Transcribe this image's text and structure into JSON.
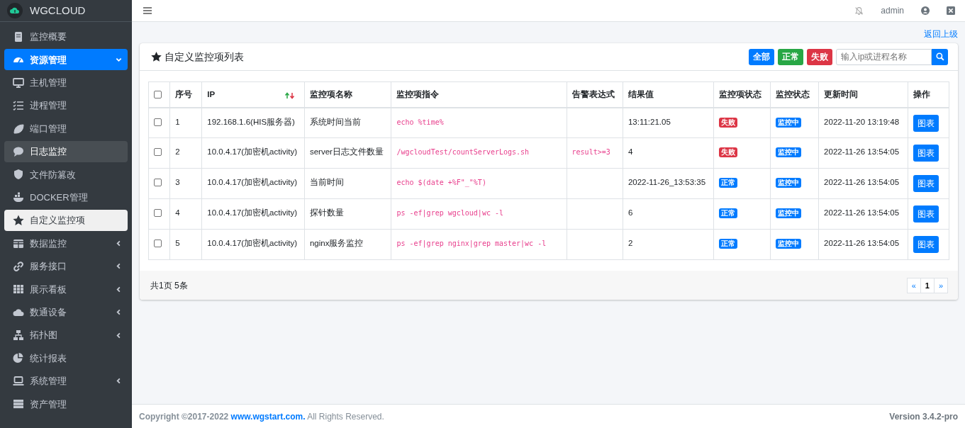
{
  "brand": {
    "name": "WGCLOUD"
  },
  "sidebar": {
    "items": [
      {
        "label": "监控概要",
        "has_submenu": false,
        "expanded": false,
        "selected": false,
        "hovered": false
      },
      {
        "label": "资源管理",
        "has_submenu": true,
        "expanded": true,
        "selected": false,
        "hovered": false
      },
      {
        "label": "主机管理",
        "has_submenu": false,
        "expanded": false,
        "selected": false,
        "hovered": false
      },
      {
        "label": "进程管理",
        "has_submenu": false,
        "expanded": false,
        "selected": false,
        "hovered": false
      },
      {
        "label": "端口管理",
        "has_submenu": false,
        "expanded": false,
        "selected": false,
        "hovered": false
      },
      {
        "label": "日志监控",
        "has_submenu": false,
        "expanded": false,
        "selected": false,
        "hovered": true
      },
      {
        "label": "文件防篡改",
        "has_submenu": false,
        "expanded": false,
        "selected": false,
        "hovered": false
      },
      {
        "label": "DOCKER管理",
        "has_submenu": false,
        "expanded": false,
        "selected": false,
        "hovered": false
      },
      {
        "label": "自定义监控项",
        "has_submenu": false,
        "expanded": false,
        "selected": true,
        "hovered": false
      },
      {
        "label": "数据监控",
        "has_submenu": true,
        "expanded": false,
        "selected": false,
        "hovered": false
      },
      {
        "label": "服务接口",
        "has_submenu": true,
        "expanded": false,
        "selected": false,
        "hovered": false
      },
      {
        "label": "展示看板",
        "has_submenu": true,
        "expanded": false,
        "selected": false,
        "hovered": false
      },
      {
        "label": "数通设备",
        "has_submenu": true,
        "expanded": false,
        "selected": false,
        "hovered": false
      },
      {
        "label": "拓扑图",
        "has_submenu": true,
        "expanded": false,
        "selected": false,
        "hovered": false
      },
      {
        "label": "统计报表",
        "has_submenu": false,
        "expanded": false,
        "selected": false,
        "hovered": false
      },
      {
        "label": "系统管理",
        "has_submenu": true,
        "expanded": false,
        "selected": false,
        "hovered": false
      },
      {
        "label": "资产管理",
        "has_submenu": false,
        "expanded": false,
        "selected": false,
        "hovered": false
      }
    ]
  },
  "topbar": {
    "user": "admin"
  },
  "back_link": "返回上级",
  "card": {
    "title": "自定义监控项列表",
    "filters": [
      {
        "label": "全部",
        "kind": "all"
      },
      {
        "label": "正常",
        "kind": "ok"
      },
      {
        "label": "失败",
        "kind": "fail"
      }
    ],
    "search": {
      "placeholder": "输入ip或进程名称"
    }
  },
  "table": {
    "select_all_checked": false,
    "columns": [
      "序号",
      "IP",
      "监控项名称",
      "监控项指令",
      "告警表达式",
      "结果值",
      "监控项状态",
      "监控状态",
      "更新时间",
      "操作"
    ],
    "rows": [
      {
        "checked": false,
        "index": "1",
        "ip": "192.168.1.6(HIS服务器)",
        "name": "系统时间当前",
        "command": "echo %time%",
        "result": "13:11:21.05",
        "item_status": {
          "label": "失败",
          "kind": "fail"
        },
        "monitor_status": "监控中",
        "updated": "2022-11-20 13:19:48",
        "action": "图表"
      },
      {
        "checked": false,
        "index": "2",
        "ip": "10.0.4.17(加密机activity)",
        "name": "server日志文件数量",
        "command": "/wgcloudTest/countServerLogs.sh",
        "expression": "result>=3",
        "result": "4",
        "item_status": {
          "label": "失败",
          "kind": "fail"
        },
        "monitor_status": "监控中",
        "updated": "2022-11-26 13:54:05",
        "action": "图表"
      },
      {
        "checked": false,
        "index": "3",
        "ip": "10.0.4.17(加密机activity)",
        "name": "当前时间",
        "command": "echo $(date +%F\"_\"%T)",
        "result": "2022-11-26_13:53:35",
        "item_status": {
          "label": "正常",
          "kind": "ok"
        },
        "monitor_status": "监控中",
        "updated": "2022-11-26 13:54:05",
        "action": "图表"
      },
      {
        "checked": false,
        "index": "4",
        "ip": "10.0.4.17(加密机activity)",
        "name": "探针数量",
        "command": "ps -ef|grep wgcloud|wc -l",
        "result": "6",
        "item_status": {
          "label": "正常",
          "kind": "ok"
        },
        "monitor_status": "监控中",
        "updated": "2022-11-26 13:54:05",
        "action": "图表"
      },
      {
        "checked": false,
        "index": "5",
        "ip": "10.0.4.17(加密机activity)",
        "name": "nginx服务监控",
        "command": "ps -ef|grep nginx|grep master|wc -l",
        "result": "2",
        "item_status": {
          "label": "正常",
          "kind": "ok"
        },
        "monitor_status": "监控中",
        "updated": "2022-11-26 13:54:05",
        "action": "图表"
      }
    ]
  },
  "pagination": {
    "summary": "共1页 5条",
    "pages": [
      {
        "label": "«",
        "selected": false
      },
      {
        "label": "1",
        "selected": true
      },
      {
        "label": "»",
        "selected": false
      }
    ]
  },
  "footer": {
    "copyright": "Copyright ©2017-2022",
    "link": "www.wgstart.com.",
    "rights": "All Rights Reserved.",
    "version": "Version 3.4.2-pro"
  }
}
